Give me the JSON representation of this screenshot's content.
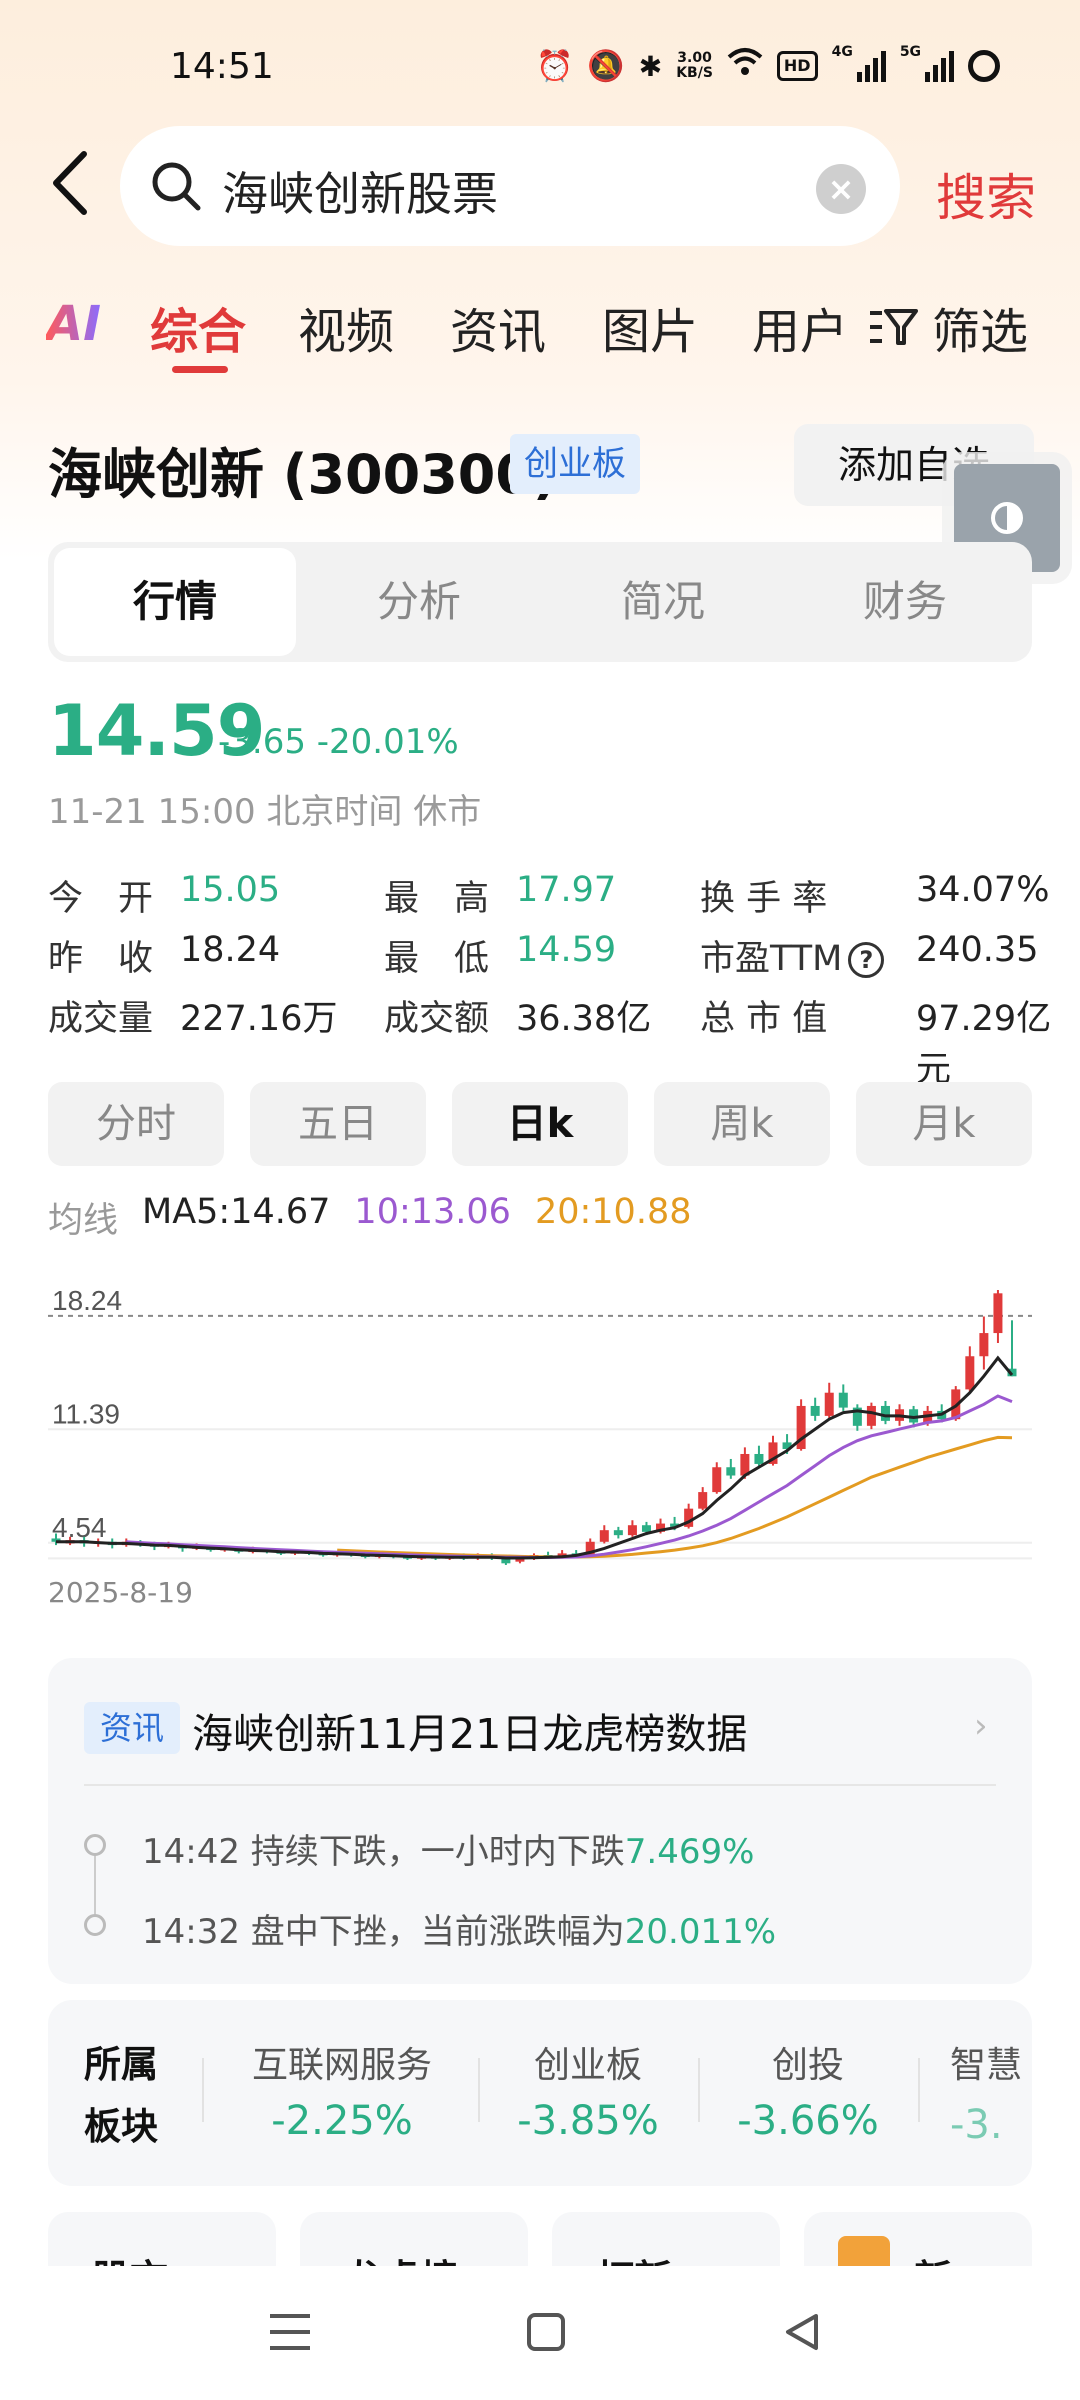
{
  "status_bar": {
    "time": "14:51",
    "net_speed_value": "3.00",
    "net_speed_unit": "KB/S",
    "hd_label": "HD",
    "sim1_label": "4G",
    "sim2_label": "5G",
    "icons": [
      "alarm-icon",
      "mute-icon",
      "bluetooth-icon",
      "wifi-icon",
      "hd-voice-icon",
      "signal-icon",
      "battery-icon"
    ]
  },
  "search": {
    "query": "海峡创新股票",
    "submit_label": "搜索"
  },
  "category_tabs": {
    "ai_label": "AI",
    "items": [
      "综合",
      "视频",
      "资讯",
      "图片",
      "用户"
    ],
    "active": "综合",
    "filter_label": "筛选"
  },
  "stock": {
    "name": "海峡创新 (300300)",
    "board": "创业板",
    "add_watch_label": "添加自选"
  },
  "detail_tabs": {
    "items": [
      "行情",
      "分析",
      "简况",
      "财务"
    ],
    "active": "行情"
  },
  "quote": {
    "price": "14.59",
    "change": "-3.65 -20.01%",
    "time": "11-21 15:00 北京时间 休市",
    "fields": [
      {
        "label": "今　开",
        "value": "15.05",
        "color": "green"
      },
      {
        "label": "最　高",
        "value": "17.97",
        "color": "green"
      },
      {
        "label": "换 手 率",
        "value": "34.07%",
        "color": "normal"
      },
      {
        "label": "昨　收",
        "value": "18.24",
        "color": "normal"
      },
      {
        "label": "最　低",
        "value": "14.59",
        "color": "green"
      },
      {
        "label": "市盈TTM",
        "value": "240.35",
        "color": "normal"
      },
      {
        "label": "成交量",
        "value": "227.16万",
        "color": "normal"
      },
      {
        "label": "成交额",
        "value": "36.38亿",
        "color": "normal"
      },
      {
        "label": "总 市 值",
        "value": "97.29亿元",
        "color": "normal"
      }
    ]
  },
  "period_tabs": {
    "items": [
      "分时",
      "五日",
      "日k",
      "周k",
      "月k"
    ],
    "active": "日k"
  },
  "ma": {
    "label": "均线",
    "ma5": "MA5:14.67",
    "ma10": "10:13.06",
    "ma20": "20:10.88"
  },
  "chart_data": {
    "type": "candlestick",
    "y_ticks": [
      "18.24",
      "11.39",
      "4.54"
    ],
    "start_date": "2025-8-19",
    "reference_line": 18.24,
    "ylim": [
      3.5,
      19.8
    ],
    "candles": [
      {
        "o": 4.8,
        "c": 4.6,
        "h": 5.1,
        "l": 4.4
      },
      {
        "o": 4.5,
        "c": 4.7,
        "h": 4.9,
        "l": 4.4
      },
      {
        "o": 4.7,
        "c": 4.5,
        "h": 4.9,
        "l": 4.3
      },
      {
        "o": 4.5,
        "c": 4.6,
        "h": 4.8,
        "l": 4.3
      },
      {
        "o": 4.6,
        "c": 4.4,
        "h": 4.8,
        "l": 4.2
      },
      {
        "o": 4.4,
        "c": 4.6,
        "h": 4.8,
        "l": 4.3
      },
      {
        "o": 4.6,
        "c": 4.5,
        "h": 4.7,
        "l": 4.3
      },
      {
        "o": 4.5,
        "c": 4.3,
        "h": 4.6,
        "l": 4.1
      },
      {
        "o": 4.3,
        "c": 4.4,
        "h": 4.6,
        "l": 4.2
      },
      {
        "o": 4.4,
        "c": 4.2,
        "h": 4.5,
        "l": 4.0
      },
      {
        "o": 4.2,
        "c": 4.3,
        "h": 4.5,
        "l": 4.1
      },
      {
        "o": 4.3,
        "c": 4.1,
        "h": 4.4,
        "l": 4.0
      },
      {
        "o": 4.1,
        "c": 4.2,
        "h": 4.3,
        "l": 4.0
      },
      {
        "o": 4.2,
        "c": 4.0,
        "h": 4.3,
        "l": 3.9
      },
      {
        "o": 4.0,
        "c": 4.1,
        "h": 4.3,
        "l": 3.9
      },
      {
        "o": 4.1,
        "c": 4.0,
        "h": 4.2,
        "l": 3.9
      },
      {
        "o": 4.0,
        "c": 3.9,
        "h": 4.1,
        "l": 3.8
      },
      {
        "o": 3.9,
        "c": 4.0,
        "h": 4.1,
        "l": 3.8
      },
      {
        "o": 4.0,
        "c": 3.9,
        "h": 4.1,
        "l": 3.8
      },
      {
        "o": 3.9,
        "c": 3.8,
        "h": 4.0,
        "l": 3.7
      },
      {
        "o": 3.8,
        "c": 3.9,
        "h": 4.0,
        "l": 3.7
      },
      {
        "o": 3.9,
        "c": 3.8,
        "h": 4.0,
        "l": 3.7
      },
      {
        "o": 3.8,
        "c": 3.7,
        "h": 3.9,
        "l": 3.6
      },
      {
        "o": 3.7,
        "c": 3.8,
        "h": 3.9,
        "l": 3.6
      },
      {
        "o": 3.8,
        "c": 3.7,
        "h": 3.9,
        "l": 3.6
      },
      {
        "o": 3.7,
        "c": 3.6,
        "h": 3.8,
        "l": 3.5
      },
      {
        "o": 3.6,
        "c": 3.7,
        "h": 3.8,
        "l": 3.5
      },
      {
        "o": 3.7,
        "c": 3.6,
        "h": 3.8,
        "l": 3.5
      },
      {
        "o": 3.6,
        "c": 3.7,
        "h": 3.8,
        "l": 3.5
      },
      {
        "o": 3.7,
        "c": 3.6,
        "h": 3.9,
        "l": 3.5
      },
      {
        "o": 3.6,
        "c": 3.8,
        "h": 3.9,
        "l": 3.5
      },
      {
        "o": 3.8,
        "c": 3.6,
        "h": 3.9,
        "l": 3.5
      },
      {
        "o": 3.6,
        "c": 3.3,
        "h": 3.7,
        "l": 3.2
      },
      {
        "o": 3.4,
        "c": 3.6,
        "h": 3.8,
        "l": 3.3
      },
      {
        "o": 3.6,
        "c": 3.8,
        "h": 3.9,
        "l": 3.5
      },
      {
        "o": 3.8,
        "c": 3.7,
        "h": 4.0,
        "l": 3.6
      },
      {
        "o": 3.7,
        "c": 3.9,
        "h": 4.1,
        "l": 3.6
      },
      {
        "o": 3.9,
        "c": 3.8,
        "h": 4.1,
        "l": 3.7
      },
      {
        "o": 3.8,
        "c": 4.6,
        "h": 4.8,
        "l": 3.7
      },
      {
        "o": 4.6,
        "c": 5.3,
        "h": 5.6,
        "l": 4.5
      },
      {
        "o": 5.3,
        "c": 5.0,
        "h": 5.5,
        "l": 4.8
      },
      {
        "o": 5.0,
        "c": 5.6,
        "h": 5.9,
        "l": 4.9
      },
      {
        "o": 5.6,
        "c": 5.2,
        "h": 5.8,
        "l": 5.0
      },
      {
        "o": 5.2,
        "c": 5.7,
        "h": 6.0,
        "l": 5.1
      },
      {
        "o": 5.7,
        "c": 5.5,
        "h": 6.1,
        "l": 5.3
      },
      {
        "o": 5.5,
        "c": 6.6,
        "h": 6.9,
        "l": 5.4
      },
      {
        "o": 6.6,
        "c": 7.6,
        "h": 7.9,
        "l": 6.5
      },
      {
        "o": 7.6,
        "c": 9.1,
        "h": 9.4,
        "l": 7.5
      },
      {
        "o": 9.1,
        "c": 8.6,
        "h": 9.6,
        "l": 8.4
      },
      {
        "o": 8.6,
        "c": 9.9,
        "h": 10.3,
        "l": 8.4
      },
      {
        "o": 9.9,
        "c": 9.3,
        "h": 10.4,
        "l": 9.1
      },
      {
        "o": 9.3,
        "c": 10.6,
        "h": 11.0,
        "l": 9.2
      },
      {
        "o": 10.6,
        "c": 10.2,
        "h": 11.1,
        "l": 9.9
      },
      {
        "o": 10.2,
        "c": 12.8,
        "h": 13.2,
        "l": 10.1
      },
      {
        "o": 12.8,
        "c": 12.2,
        "h": 13.3,
        "l": 11.9
      },
      {
        "o": 12.2,
        "c": 13.6,
        "h": 14.2,
        "l": 12.0
      },
      {
        "o": 13.6,
        "c": 12.7,
        "h": 14.1,
        "l": 12.5
      },
      {
        "o": 12.7,
        "c": 11.6,
        "h": 12.9,
        "l": 11.3
      },
      {
        "o": 11.6,
        "c": 12.8,
        "h": 13.0,
        "l": 11.4
      },
      {
        "o": 12.8,
        "c": 11.9,
        "h": 13.1,
        "l": 11.7
      },
      {
        "o": 11.9,
        "c": 12.6,
        "h": 12.9,
        "l": 11.6
      },
      {
        "o": 12.6,
        "c": 11.8,
        "h": 12.8,
        "l": 11.5
      },
      {
        "o": 11.8,
        "c": 12.5,
        "h": 12.8,
        "l": 11.6
      },
      {
        "o": 12.5,
        "c": 12.0,
        "h": 12.9,
        "l": 11.8
      },
      {
        "o": 12.0,
        "c": 13.8,
        "h": 14.0,
        "l": 11.9
      },
      {
        "o": 13.8,
        "c": 15.8,
        "h": 16.4,
        "l": 13.6
      },
      {
        "o": 15.8,
        "c": 17.2,
        "h": 18.2,
        "l": 15.0
      },
      {
        "o": 17.2,
        "c": 19.6,
        "h": 19.9,
        "l": 16.6
      },
      {
        "o": 15.05,
        "c": 14.59,
        "h": 17.97,
        "l": 14.59
      }
    ],
    "ma5": [
      4.6,
      4.6,
      4.6,
      4.55,
      4.5,
      4.5,
      4.45,
      4.4,
      4.38,
      4.32,
      4.26,
      4.22,
      4.18,
      4.12,
      4.08,
      4.05,
      4.0,
      3.98,
      3.95,
      3.9,
      3.88,
      3.85,
      3.8,
      3.78,
      3.76,
      3.72,
      3.7,
      3.68,
      3.67,
      3.66,
      3.66,
      3.66,
      3.62,
      3.62,
      3.64,
      3.66,
      3.7,
      3.78,
      3.96,
      4.2,
      4.5,
      4.8,
      5.1,
      5.3,
      5.45,
      5.8,
      6.3,
      7.1,
      7.8,
      8.6,
      9.1,
      9.6,
      10.1,
      10.8,
      11.4,
      12.0,
      12.4,
      12.5,
      12.4,
      12.2,
      12.2,
      12.1,
      12.2,
      12.3,
      12.8,
      13.6,
      14.6,
      15.7,
      14.67
    ],
    "ma10": [
      null,
      null,
      null,
      null,
      null,
      4.6,
      4.55,
      4.5,
      4.47,
      4.42,
      4.38,
      4.34,
      4.3,
      4.25,
      4.2,
      4.16,
      4.12,
      4.08,
      4.04,
      4.0,
      3.97,
      3.94,
      3.91,
      3.88,
      3.85,
      3.82,
      3.79,
      3.76,
      3.74,
      3.72,
      3.7,
      3.69,
      3.67,
      3.66,
      3.65,
      3.65,
      3.66,
      3.68,
      3.75,
      3.85,
      3.98,
      4.12,
      4.3,
      4.5,
      4.7,
      4.95,
      5.25,
      5.6,
      6.0,
      6.5,
      7.0,
      7.5,
      8.0,
      8.6,
      9.2,
      9.8,
      10.3,
      10.7,
      11.0,
      11.2,
      11.4,
      11.6,
      11.8,
      11.9,
      12.1,
      12.5,
      12.9,
      13.4,
      13.06
    ],
    "ma20": [
      null,
      null,
      null,
      null,
      null,
      null,
      null,
      null,
      null,
      null,
      null,
      null,
      null,
      null,
      null,
      null,
      null,
      null,
      null,
      null,
      4.1,
      4.06,
      4.02,
      3.98,
      3.95,
      3.92,
      3.89,
      3.86,
      3.83,
      3.8,
      3.78,
      3.76,
      3.74,
      3.72,
      3.7,
      3.69,
      3.68,
      3.68,
      3.7,
      3.73,
      3.78,
      3.84,
      3.92,
      4.0,
      4.1,
      4.22,
      4.36,
      4.55,
      4.8,
      5.1,
      5.4,
      5.75,
      6.1,
      6.5,
      6.9,
      7.3,
      7.7,
      8.1,
      8.5,
      8.8,
      9.1,
      9.4,
      9.7,
      9.95,
      10.2,
      10.45,
      10.7,
      10.9,
      10.88
    ]
  },
  "news": {
    "tag": "资讯",
    "title": "海峡创新11月21日龙虎榜数据",
    "items": [
      {
        "time": "14:42",
        "text": "持续下跌，一小时内下跌",
        "pct": "7.469%"
      },
      {
        "time": "14:32",
        "text": "盘中下挫，当前涨跌幅为",
        "pct": "20.011%"
      }
    ]
  },
  "sectors": {
    "title": "所属板块",
    "items": [
      {
        "name": "互联网服务",
        "value": "-2.25%"
      },
      {
        "name": "创业板",
        "value": "-3.85%"
      },
      {
        "name": "创投",
        "value": "-3.66%"
      },
      {
        "name": "智慧",
        "value": "-3."
      }
    ]
  },
  "quick_cards": [
    "股市",
    "龙虎榜",
    "打新",
    "新"
  ],
  "colors": {
    "accent_red": "#e03a3a",
    "down_green": "#2bae85",
    "ma5": "#222222",
    "ma10": "#9b59d0",
    "ma20": "#e39b21",
    "board_blue": "#2d6fd6"
  }
}
